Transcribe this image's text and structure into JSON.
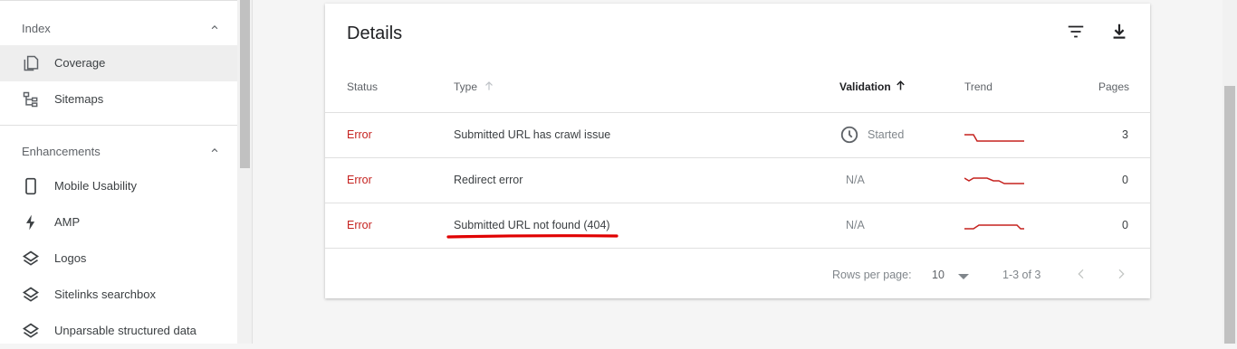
{
  "sidebar": {
    "index_header": "Index",
    "enhancements_header": "Enhancements",
    "items": [
      {
        "label": "Coverage",
        "icon": "coverage-icon",
        "active": true
      },
      {
        "label": "Sitemaps",
        "icon": "sitemaps-icon"
      },
      {
        "label": "Mobile Usability",
        "icon": "phone-icon"
      },
      {
        "label": "AMP",
        "icon": "bolt-icon"
      },
      {
        "label": "Logos",
        "icon": "layers-icon"
      },
      {
        "label": "Sitelinks searchbox",
        "icon": "layers-icon"
      },
      {
        "label": "Unparsable structured data",
        "icon": "layers-icon"
      }
    ]
  },
  "details": {
    "title": "Details",
    "columns": {
      "status": "Status",
      "type": "Type",
      "validation": "Validation",
      "trend": "Trend",
      "pages": "Pages"
    },
    "rows": [
      {
        "status": "Error",
        "type": "Submitted URL has crawl issue",
        "validation": "Started",
        "pages": "3"
      },
      {
        "status": "Error",
        "type": "Redirect error",
        "validation": "N/A",
        "pages": "0"
      },
      {
        "status": "Error",
        "type": "Submitted URL not found (404)",
        "validation": "N/A",
        "pages": "0"
      }
    ],
    "footer": {
      "rows_per_page_label": "Rows per page:",
      "rows_per_page_value": "10",
      "range": "1-3 of 3"
    }
  },
  "colors": {
    "error": "#c5221f",
    "annotation": "#e00000"
  }
}
